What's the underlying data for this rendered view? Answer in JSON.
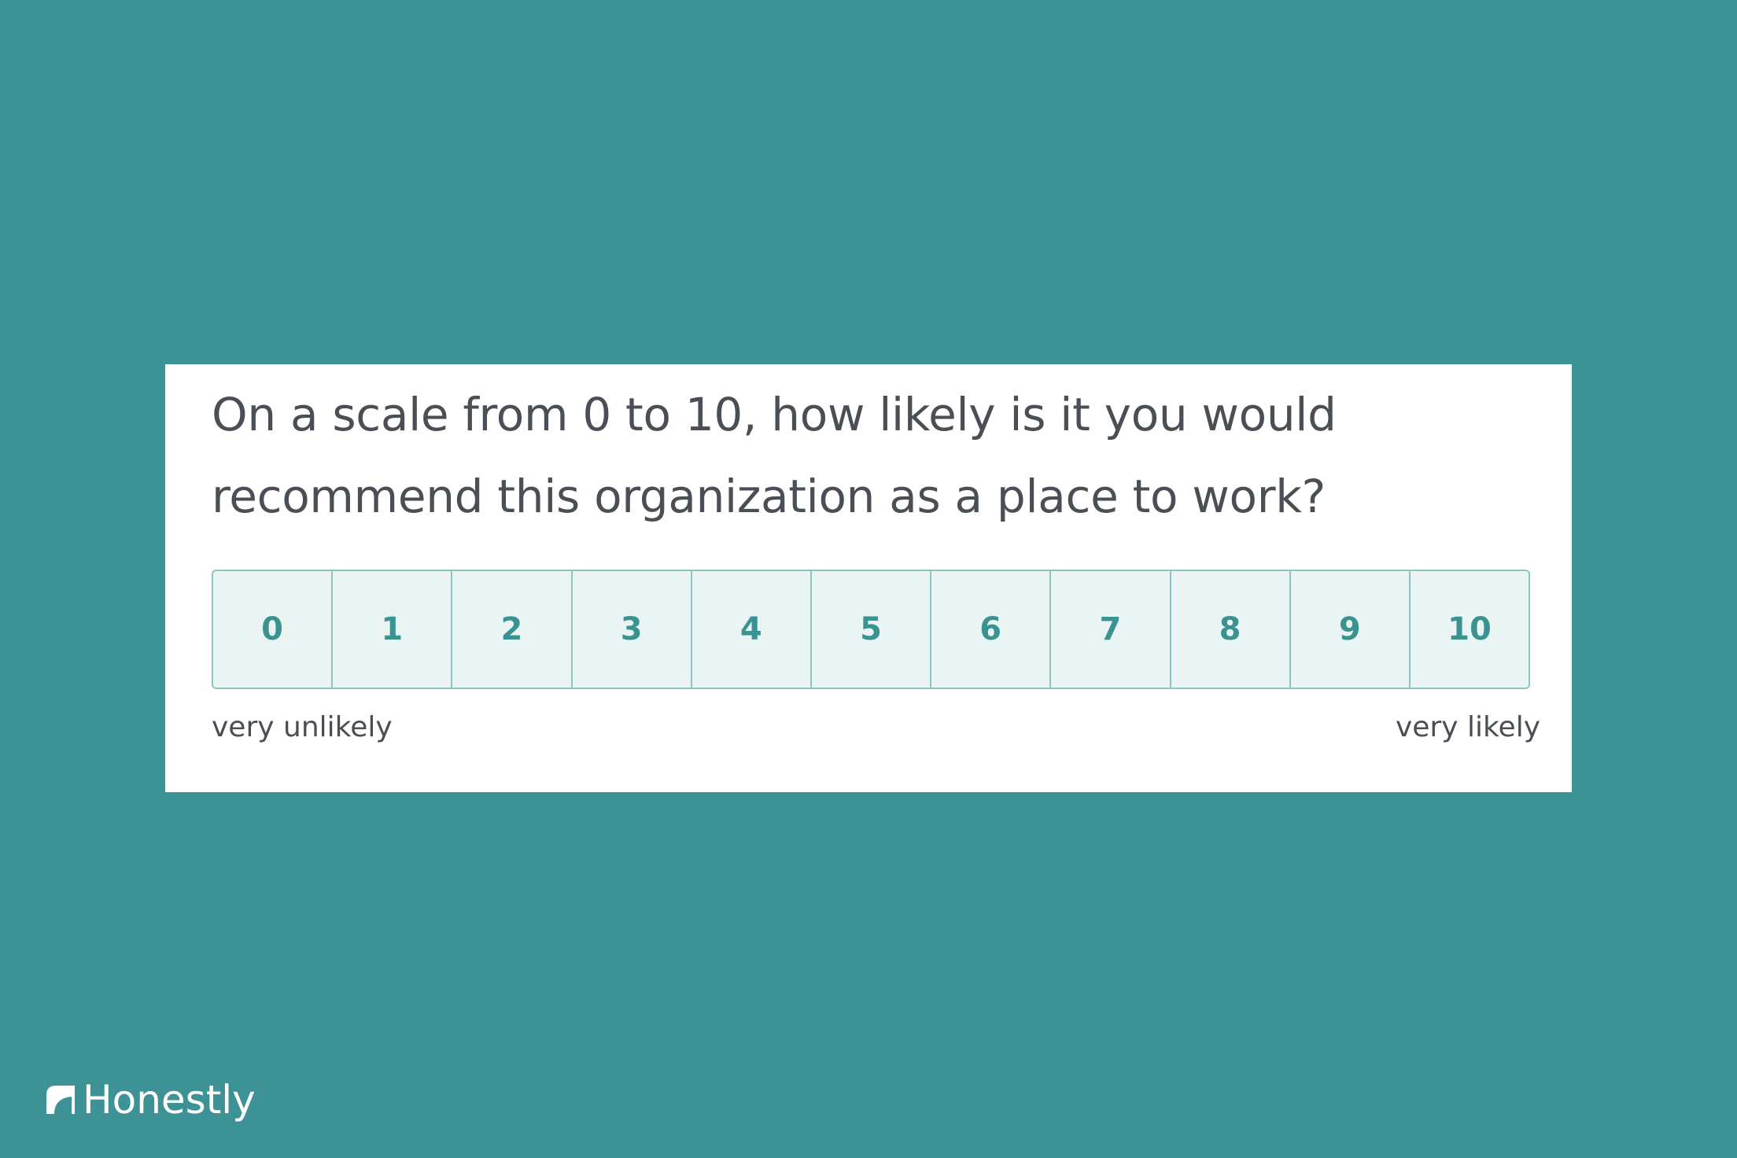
{
  "survey": {
    "question": "On a scale from 0 to 10, how likely is it you would recommend this organization as a place to work?",
    "options": [
      "0",
      "1",
      "2",
      "3",
      "4",
      "5",
      "6",
      "7",
      "8",
      "9",
      "10"
    ],
    "label_low": "very unlikely",
    "label_high": "very likely"
  },
  "brand": {
    "name": "Honestly",
    "icon": "honestly-logo-icon"
  },
  "colors": {
    "background": "#3c9294",
    "card": "#ffffff",
    "option_fill": "#eaf4f2",
    "option_border": "#8ac6c2",
    "option_text": "#3a9390",
    "text": "#4a4e55"
  }
}
